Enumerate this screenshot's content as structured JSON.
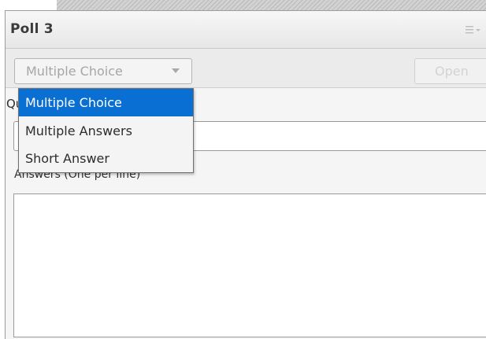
{
  "colors": {
    "selection": "#0a6fd3",
    "panel_bg": "#f2f2f2"
  },
  "poll": {
    "title": "Poll 3",
    "menu_icon": "hamburger-menu-icon"
  },
  "toolbar": {
    "type_select_value": "Multiple Choice",
    "caret_icon": "caret-down-icon",
    "open_label": "Open"
  },
  "dropdown": {
    "options": [
      {
        "label": "Multiple Choice",
        "selected": true
      },
      {
        "label": "Multiple Answers",
        "selected": false
      },
      {
        "label": "Short Answer",
        "selected": false
      }
    ]
  },
  "form": {
    "question_label": "Question",
    "question_value": "",
    "answers_label": "Answers (One per line)",
    "answers_value": ""
  }
}
